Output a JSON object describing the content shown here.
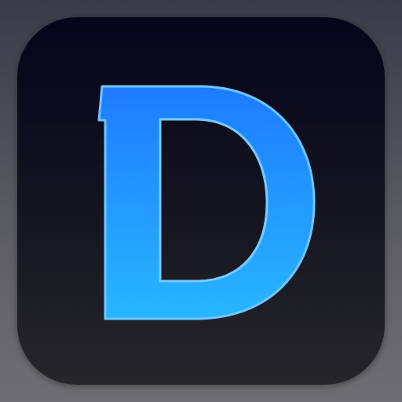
{
  "app_icon": {
    "glyph": "D",
    "colors": {
      "background_top": "#3a3a4a",
      "background_bottom": "#6e6e72",
      "tile_top": "#05051b",
      "tile_bottom": "#262629",
      "glyph_top": "#1e7bff",
      "glyph_bottom": "#27b6ff",
      "glyph_outline": "#6fc6ff"
    }
  }
}
